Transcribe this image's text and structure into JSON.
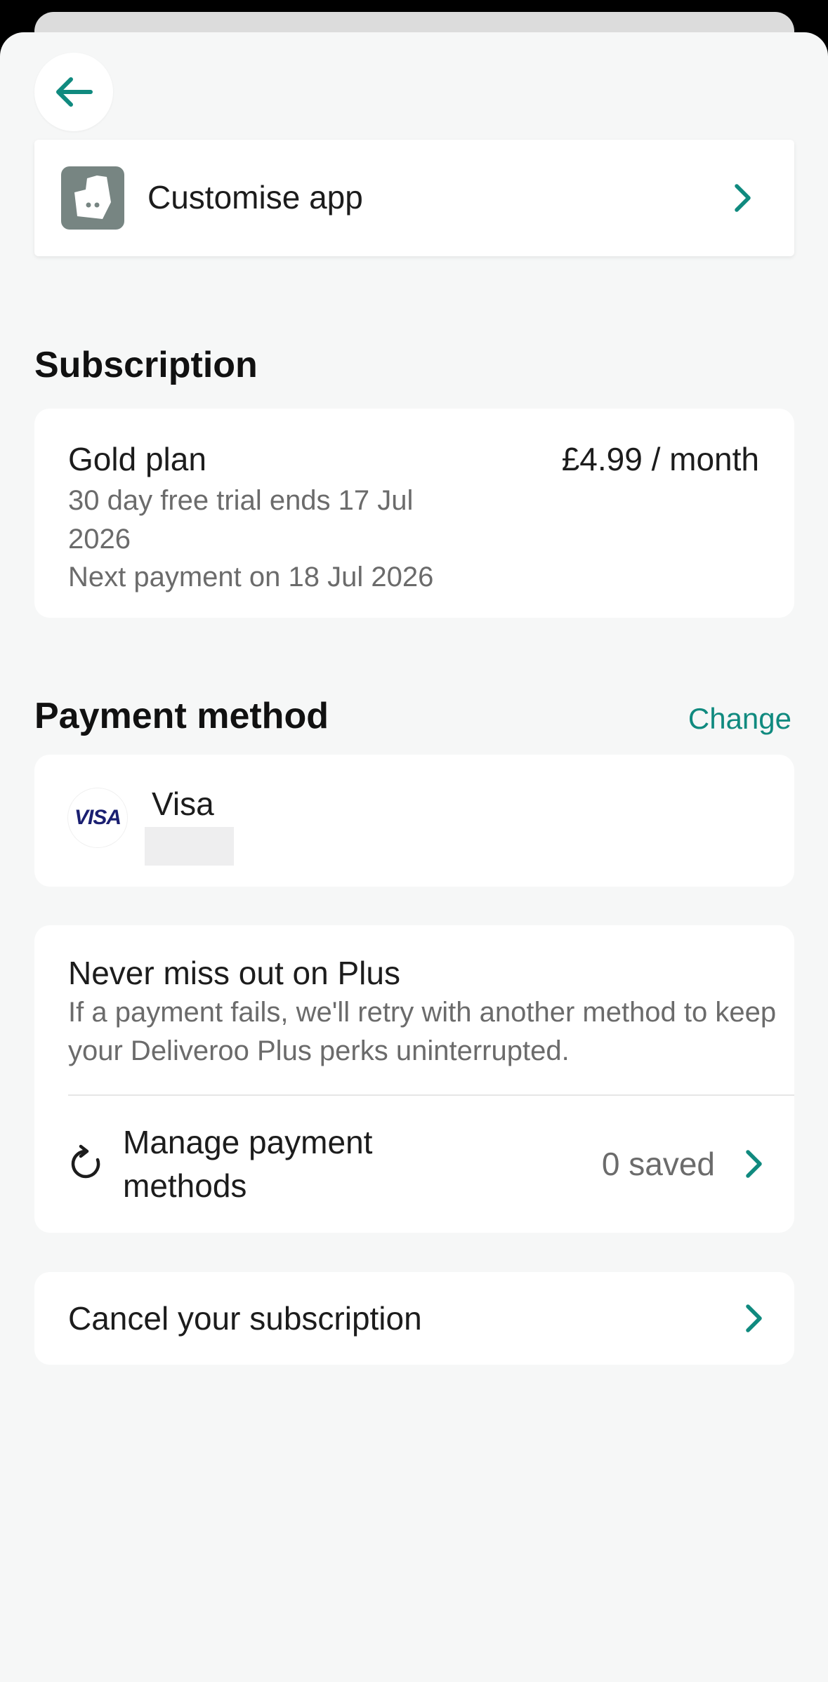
{
  "customise": {
    "label": "Customise app",
    "icon": "deliveroo-logo-icon"
  },
  "subscription": {
    "title": "Subscription",
    "plan_name": "Gold plan",
    "price": "£4.99 / month",
    "trial": "30 day free trial ends 17 Jul 2026",
    "next_payment": "Next payment on 18 Jul 2026"
  },
  "payment": {
    "title": "Payment method",
    "change_label": "Change",
    "card_brand_logo": "VISA",
    "card_label": "Visa"
  },
  "plus": {
    "title": "Never miss out on Plus",
    "description": "If a payment fails, we'll retry with another method to keep your Deliveroo Plus perks uninterrupted.",
    "manage_label": "Manage payment methods",
    "saved_count": "0 saved"
  },
  "cancel": {
    "label": "Cancel your subscription"
  },
  "colors": {
    "accent": "#108a7f",
    "background": "#f6f7f7",
    "card": "#ffffff"
  }
}
